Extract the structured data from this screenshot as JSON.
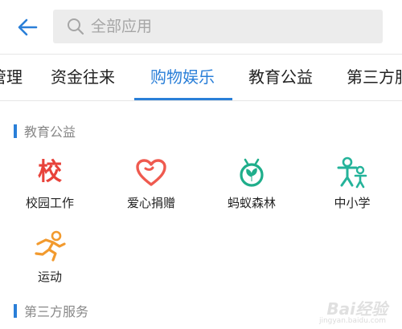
{
  "header": {
    "search_placeholder": "全部应用"
  },
  "tabs": [
    {
      "label": "管理",
      "active": false
    },
    {
      "label": "资金往来",
      "active": false
    },
    {
      "label": "购物娱乐",
      "active": true
    },
    {
      "label": "教育公益",
      "active": false
    },
    {
      "label": "第三方服务",
      "active": false
    }
  ],
  "sections": [
    {
      "title": "教育公益",
      "apps": [
        {
          "name": "校园工作",
          "icon": "school-icon",
          "glyph": "校",
          "color": "#e8423a"
        },
        {
          "name": "爱心捐赠",
          "icon": "heart-icon",
          "color": "#ef5a4f"
        },
        {
          "name": "蚂蚁森林",
          "icon": "ant-forest-icon",
          "color": "#1fae8b"
        },
        {
          "name": "中小学",
          "icon": "students-icon",
          "color": "#24b39a"
        },
        {
          "name": "运动",
          "icon": "running-icon",
          "color": "#f29a2e"
        }
      ]
    },
    {
      "title": "第三方服务",
      "apps": []
    }
  ],
  "watermark": {
    "text": "Bai经验",
    "sub": "jingyan.baidu.com"
  },
  "colors": {
    "accent": "#2a7fd8"
  }
}
